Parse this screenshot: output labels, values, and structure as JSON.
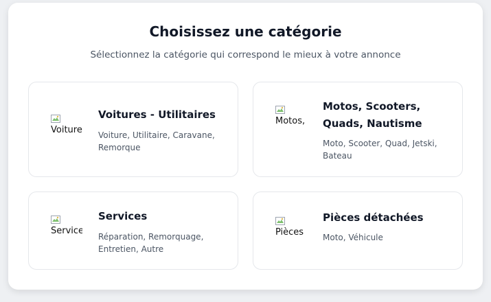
{
  "header": {
    "title": "Choisissez une catégorie",
    "subtitle": "Sélectionnez la catégorie qui correspond le mieux à votre annonce"
  },
  "categories": [
    {
      "title": "Voitures - Utilitaires",
      "description": "Voiture, Utilitaire, Caravane, Remorque",
      "image_alt": "Voitures",
      "image_icon": "broken-image-icon"
    },
    {
      "title": "Motos, Scooters, Quads, Nautisme",
      "description": "Moto, Scooter, Quad, Jetski, Bateau",
      "image_alt": "Motos, Scooters",
      "image_icon": "broken-image-icon"
    },
    {
      "title": "Services",
      "description": "Réparation, Remorquage, Entretien, Autre",
      "image_alt": "Services",
      "image_icon": "broken-image-icon"
    },
    {
      "title": "Pièces détachées",
      "description": "Moto, Véhicule",
      "image_alt": "Pièces détachées",
      "image_icon": "broken-image-icon"
    }
  ],
  "colors": {
    "title": "#111827",
    "text_muted": "#4b5563",
    "card_border": "#e5e7eb",
    "background": "#eef0f3"
  }
}
